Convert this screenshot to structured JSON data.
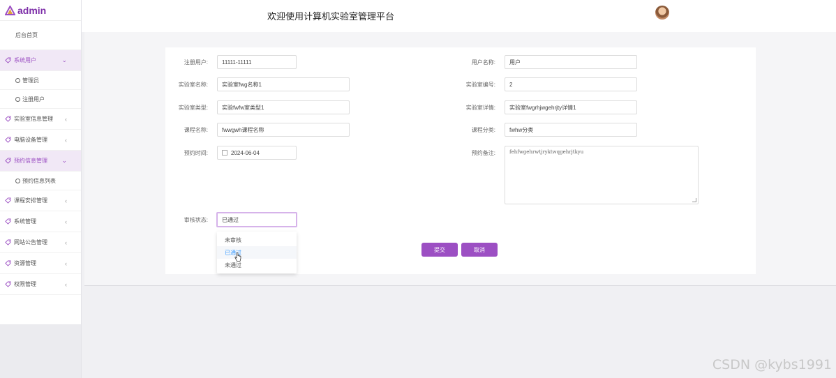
{
  "app": {
    "logo_text": "admin",
    "header_title": "欢迎使用计算机实验室管理平台"
  },
  "colors": {
    "brand": "#9c4fc3",
    "active_bg": "#f1e8f6"
  },
  "sidebar": {
    "home": "后台首页",
    "items": [
      {
        "label": "系统用户",
        "icon": "tag-icon",
        "expanded": true,
        "children": [
          "管理员",
          "注册用户"
        ]
      },
      {
        "label": "实验室信息管理",
        "icon": "tag-icon"
      },
      {
        "label": "电脑设备管理",
        "icon": "tag-icon"
      },
      {
        "label": "预约信息管理",
        "icon": "tag-icon",
        "expanded": true,
        "children": [
          "预约信息列表"
        ]
      },
      {
        "label": "课程安排管理",
        "icon": "tag-icon"
      },
      {
        "label": "系统管理",
        "icon": "tag-icon"
      },
      {
        "label": "网站公告管理",
        "icon": "tag-icon"
      },
      {
        "label": "资源管理",
        "icon": "tag-icon"
      },
      {
        "label": "权限管理",
        "icon": "tag-icon"
      }
    ]
  },
  "form": {
    "register_user": {
      "label": "注册用户:",
      "value": "11111-11111"
    },
    "user_name": {
      "label": "用户名称:",
      "value": "用户"
    },
    "lab_name": {
      "label": "实验室名称:",
      "value": "实验室fwg名称1"
    },
    "lab_no": {
      "label": "实验室编号:",
      "value": "2"
    },
    "lab_type": {
      "label": "实验室类型:",
      "value": "实验fwfw室类型1"
    },
    "lab_detail": {
      "label": "实验室详情:",
      "value": "实验室fwgrhjwgehrjty详情1"
    },
    "course_name": {
      "label": "课程名称:",
      "value": "fwwgwh课程名称"
    },
    "course_cat": {
      "label": "课程分类:",
      "value": "fwhw分类"
    },
    "book_time": {
      "label": "预约时间:",
      "value": "2024-06-04"
    },
    "book_note": {
      "label": "预约备注:",
      "value": "fehfwgehrwtjryktwqgehrjtkyu"
    },
    "audit_status": {
      "label": "审核状态:",
      "value": "已通过",
      "options": [
        "未审核",
        "已通过",
        "未通过"
      ]
    },
    "submit": "提交",
    "cancel": "取消"
  },
  "watermark": "CSDN @kybs1991"
}
